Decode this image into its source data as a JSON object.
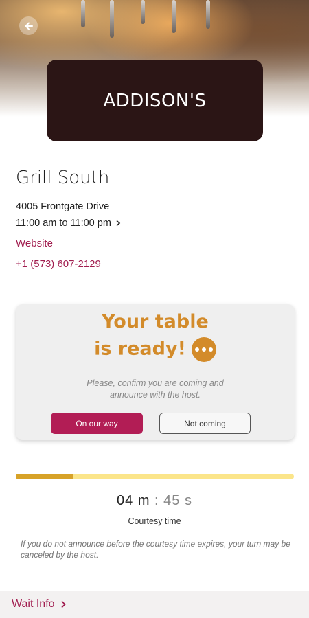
{
  "header": {
    "logo_text": "ADDISON'S"
  },
  "restaurant": {
    "name": "Grill South",
    "address": "4005 Frontgate Drive",
    "hours": "11:00 am to 11:00 pm",
    "website_label": "Website",
    "phone": "+1 (573) 607-2129"
  },
  "status_card": {
    "title_line1": "Your table",
    "title_line2": "is ready!",
    "icon": "more-dots-icon",
    "message_line1": "Please, confirm you are coming and",
    "message_line2": "announce with the host.",
    "primary_button": "On our way",
    "secondary_button": "Not coming"
  },
  "countdown": {
    "progress_fraction": 0.205,
    "minutes": "04 m",
    "separator": ":",
    "seconds": "45 s",
    "label": "Courtesy time",
    "note": "If you do not announce before the courtesy time expires, your turn may be canceled by the host."
  },
  "footer": {
    "wait_info_label": "Wait Info"
  },
  "colors": {
    "accent": "#a11d4f",
    "button_primary": "#b21d55",
    "ready_text": "#d38b2a",
    "progress_fill": "#d7a228",
    "progress_track": "#fbe58a",
    "logo_bg": "#2b1515"
  }
}
